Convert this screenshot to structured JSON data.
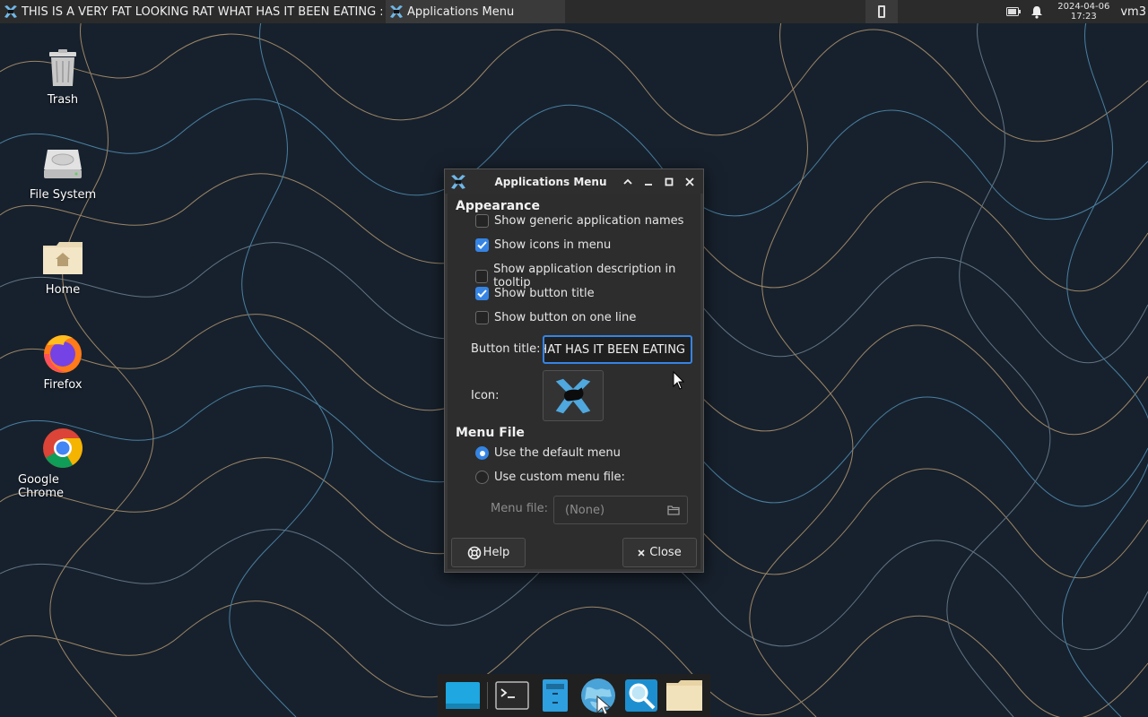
{
  "panel": {
    "task1_label": "THIS IS A VERY FAT LOOKING RAT WHAT HAS IT BEEN EATING :",
    "task2_label": "Applications Menu",
    "date": "2024-04-06",
    "time": "17:23",
    "user": "vm3"
  },
  "desktop": {
    "icons": [
      {
        "label": "Trash",
        "icon": "trash-icon"
      },
      {
        "label": "File System",
        "icon": "drive-icon"
      },
      {
        "label": "Home",
        "icon": "home-folder-icon"
      },
      {
        "label": "Firefox",
        "icon": "firefox-icon"
      },
      {
        "label": "Google Chrome",
        "icon": "chrome-icon"
      }
    ]
  },
  "dialog": {
    "title": "Applications Menu",
    "appearance_heading": "Appearance",
    "options": [
      {
        "label": "Show generic application names",
        "checked": false
      },
      {
        "label": "Show icons in menu",
        "checked": true
      },
      {
        "label": "Show application description in tooltip",
        "checked": false
      },
      {
        "label": "Show button title",
        "checked": true
      },
      {
        "label": "Show button on one line",
        "checked": false
      }
    ],
    "button_title_label": "Button title:",
    "button_title_value": "THIS IS A VERY FAT LOOKING RAT WHAT HAS IT BEEN EATING",
    "icon_label": "Icon:",
    "menu_file_heading": "Menu File",
    "radio_default": "Use the default menu",
    "radio_custom": "Use custom menu file:",
    "selected_radio": "default",
    "menu_file_label": "Menu file:",
    "menu_file_value": "(None)",
    "help_label": "Help",
    "close_label": "Close"
  },
  "colors": {
    "accent": "#3584e4",
    "panel_bg": "#2b2b2b",
    "dialog_bg": "#2d2d2d"
  }
}
